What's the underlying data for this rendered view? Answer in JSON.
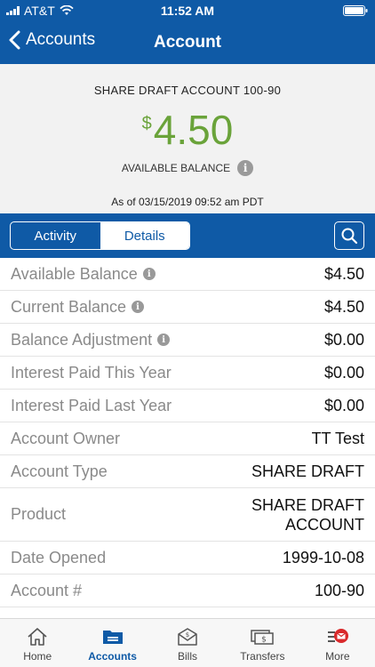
{
  "status_bar": {
    "carrier": "AT&T",
    "time": "11:52 AM"
  },
  "nav": {
    "back_label": "Accounts",
    "title": "Account"
  },
  "account": {
    "name": "SHARE DRAFT ACCOUNT 100-90",
    "currency_symbol": "$",
    "balance": "4.50",
    "balance_label": "AVAILABLE BALANCE",
    "as_of": "As of  03/15/2019 09:52 am PDT"
  },
  "tabs": {
    "activity": "Activity",
    "details": "Details",
    "active": "details"
  },
  "details": [
    {
      "label": "Available Balance",
      "value": "$4.50",
      "info": true
    },
    {
      "label": "Current Balance",
      "value": "$4.50",
      "info": true
    },
    {
      "label": "Balance Adjustment",
      "value": "$0.00",
      "info": true
    },
    {
      "label": "Interest Paid This Year",
      "value": "$0.00",
      "info": false
    },
    {
      "label": "Interest Paid Last Year",
      "value": "$0.00",
      "info": false
    },
    {
      "label": "Account Owner",
      "value": "TT Test",
      "info": false
    },
    {
      "label": "Account Type",
      "value": "SHARE DRAFT",
      "info": false
    },
    {
      "label": "Product",
      "value": "SHARE DRAFT ACCOUNT",
      "value_line1": "SHARE DRAFT",
      "value_line2": "ACCOUNT",
      "info": false
    },
    {
      "label": "Date Opened",
      "value": "1999-10-08",
      "info": false
    },
    {
      "label": "Account #",
      "value": "100-90",
      "info": false
    }
  ],
  "tab_bar": {
    "home": "Home",
    "accounts": "Accounts",
    "bills": "Bills",
    "transfers": "Transfers",
    "more": "More",
    "active": "accounts"
  },
  "colors": {
    "brand_blue": "#0f5aa6",
    "balance_green": "#6aa33a",
    "badge_red": "#d9292b"
  }
}
